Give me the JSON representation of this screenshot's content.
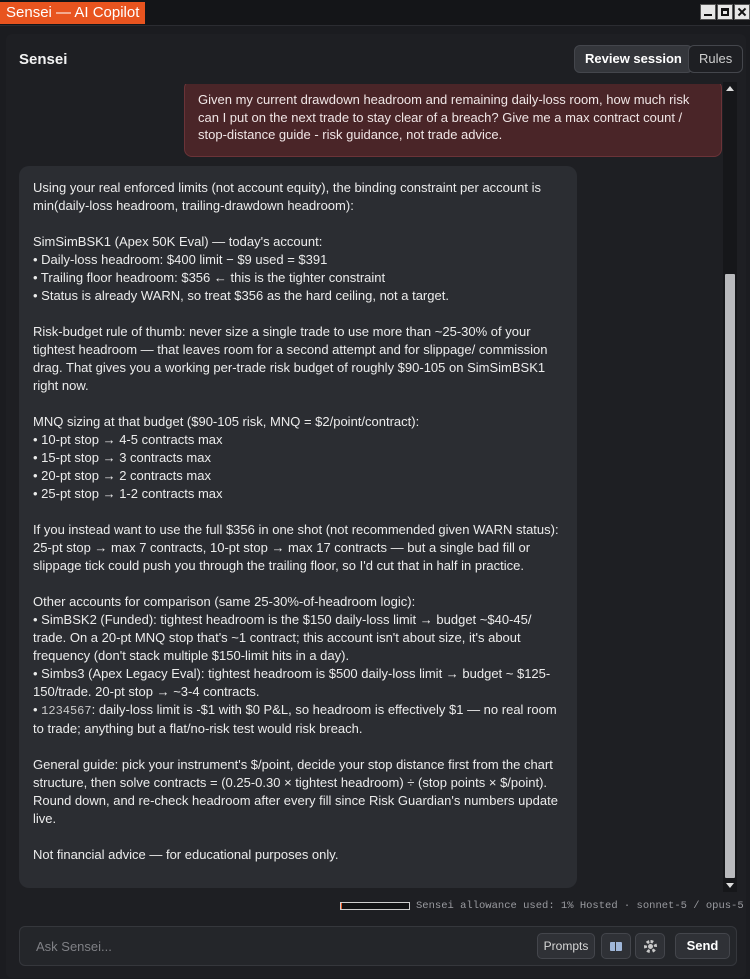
{
  "window": {
    "title": "Sensei — AI Copilot"
  },
  "header": {
    "title": "Sensei",
    "review_label": "Review session",
    "rules_label": "Rules"
  },
  "messages": {
    "user": "Given my current drawdown headroom and remaining daily-loss room, how much risk can I put on the next trade to stay clear of a breach? Give me a max contract count / stop-distance guide - risk guidance, not trade advice.",
    "assistant": {
      "intro": [
        "Using your real enforced limits (not account equity), the binding constraint per account is min(daily-loss headroom, trailing-drawdown headroom):"
      ],
      "account1": [
        "SimSimBSK1 (Apex 50K Eval) — today's account:",
        "• Daily-loss headroom: $400 limit − $9 used = $391",
        "• Trailing floor headroom: $356 ← this is the tighter constraint",
        "• Status is already WARN, so treat $356 as the hard ceiling, not a target."
      ],
      "rule": "Risk-budget rule of thumb: never size a single trade to use more than ~25-30% of your tightest headroom — that leaves room for a second attempt and for slippage/ commission drag. That gives you a working per-trade risk budget of roughly $90-105 on SimSimBSK1 right now.",
      "sizing": [
        "MNQ sizing at that budget ($90-105 risk, MNQ = $2/point/contract):",
        "• 10-pt stop → 4-5 contracts max",
        "• 15-pt stop → 3 contracts max",
        "• 20-pt stop → 2 contracts max",
        "• 25-pt stop → 1-2 contracts max"
      ],
      "full_shot": "If you instead want to use the full $356 in one shot (not recommended given WARN status): 25-pt stop → max 7 contracts, 10-pt stop → max 17 contracts — but a single bad fill or slippage tick could push you through the trailing floor, so I'd cut that in half in practice.",
      "others_header": "Other accounts for comparison (same 25-30%-of-headroom logic):",
      "others": [
        "• SimBSK2 (Funded): tightest headroom is the $150 daily-loss limit → budget ~$40-45/ trade. On a 20-pt MNQ stop that's ~1 contract; this account isn't about size, it's about frequency (don't stack multiple $150-limit hits in a day).",
        "• Simbs3 (Apex Legacy Eval): tightest headroom is $500 daily-loss limit → budget ~ $125-150/trade. 20-pt stop → ~3-4 contracts."
      ],
      "other4_bullet": "• ",
      "other4_account": "1234567",
      "other4_text": ": daily-loss limit is -$1 with $0 P&L, so headroom is effectively $1 — no real room to trade; anything but a flat/no-risk test would risk breach.",
      "guide": "General guide: pick your instrument's $/point, decide your stop distance first from the chart structure, then solve contracts = (0.25-0.30 × tightest headroom) ÷ (stop points × $/point). Round down, and re-check headroom after every fill since Risk Guardian's numbers update live.",
      "disclaimer": "Not financial advice — for educational purposes only."
    }
  },
  "usage": {
    "percent": 1,
    "text": "Sensei allowance used: 1%  Hosted · sonnet-5 / opus-5"
  },
  "input": {
    "placeholder": "Ask Sensei...",
    "prompts_label": "Prompts",
    "send_label": "Send"
  },
  "icons": {
    "book": "book-icon",
    "gear": "gear-icon"
  },
  "colors": {
    "accent": "#e8541f",
    "user_bubble": "#4a2528",
    "assistant_bubble": "#2b2d32"
  }
}
